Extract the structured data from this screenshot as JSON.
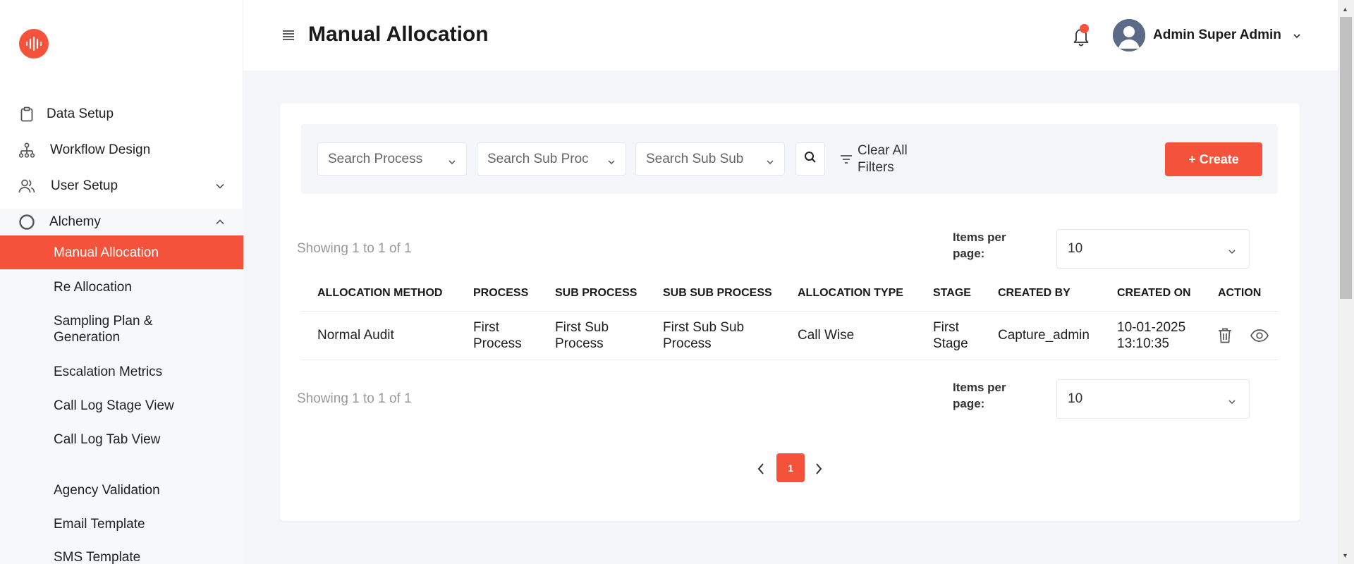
{
  "sidebar": {
    "logo_icon": "soundwave-logo-icon",
    "items": [
      {
        "label": "Data Setup",
        "icon": "clipboard-icon"
      },
      {
        "label": "Workflow Design",
        "icon": "hierarchy-icon"
      },
      {
        "label": "User Setup",
        "icon": "users-icon"
      },
      {
        "label": "Alchemy",
        "icon": "circle-icon"
      }
    ],
    "sub_items": [
      "Manual Allocation",
      "Re Allocation",
      "Sampling Plan & Generation",
      "Escalation Metrics",
      "Call Log Stage View",
      "Call Log Tab View",
      "Agency Validation",
      "Email Template",
      "SMS Template"
    ]
  },
  "header": {
    "title": "Manual Allocation",
    "user_name": "Admin Super Admin"
  },
  "filters": {
    "process_placeholder": "Search Process",
    "sub_process_placeholder": "Search Sub Proc",
    "sub_sub_process_placeholder": "Search Sub Sub",
    "clear_label": "Clear All Filters",
    "create_label": "+ Create"
  },
  "pagination_top": {
    "showing": "Showing 1 to 1 of 1",
    "items_per_page_label": "Items per page:",
    "items_per_page_value": "10"
  },
  "pagination_bottom": {
    "showing": "Showing 1 to 1 of 1",
    "items_per_page_label": "Items per page:",
    "items_per_page_value": "10",
    "current_page": "1"
  },
  "table": {
    "columns": [
      "ALLOCATION METHOD",
      "PROCESS",
      "SUB PROCESS",
      "SUB SUB PROCESS",
      "ALLOCATION TYPE",
      "STAGE",
      "CREATED BY",
      "CREATED ON",
      "ACTION"
    ],
    "rows": [
      [
        "Normal Audit",
        "First Process",
        "First Sub Process",
        "First Sub Sub Process",
        "Call Wise",
        "First Stage",
        "Capture_admin",
        "10-01-2025 13:10:35"
      ]
    ]
  },
  "colors": {
    "accent": "#f5523b",
    "background": "#f4f6fa"
  }
}
